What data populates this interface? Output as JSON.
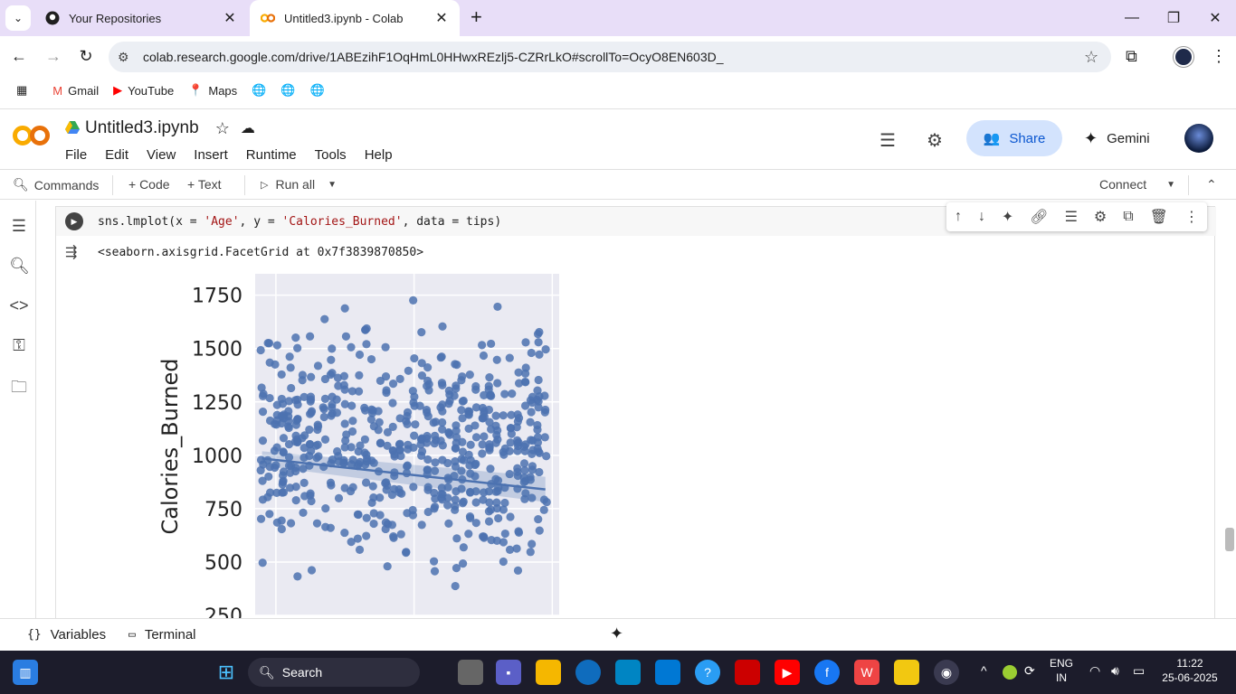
{
  "browser": {
    "tabs": [
      {
        "title": "Your Repositories",
        "icon": "github-icon"
      },
      {
        "title": "Untitled3.ipynb - Colab",
        "icon": "colab-icon"
      }
    ],
    "url": "colab.research.google.com/drive/1ABEzihF1OqHmL0HHwxREzlj5-CZRrLkO#scrollTo=OcyO8EN603D_",
    "bookmarks": [
      {
        "label": "Gmail",
        "icon": "gmail-icon"
      },
      {
        "label": "YouTube",
        "icon": "youtube-icon"
      },
      {
        "label": "Maps",
        "icon": "maps-icon"
      }
    ]
  },
  "colab": {
    "notebook_name": "Untitled3.ipynb",
    "menu": [
      "File",
      "Edit",
      "View",
      "Insert",
      "Runtime",
      "Tools",
      "Help"
    ],
    "share_label": "Share",
    "gemini_label": "Gemini",
    "toolbar": {
      "commands": "Commands",
      "code": "+ Code",
      "text": "+ Text",
      "run_all": "Run all",
      "connect": "Connect"
    },
    "cell": {
      "code_prefix": "sns.lmplot(x = ",
      "x_str": "'Age'",
      "mid": ", y = ",
      "y_str": "'Calories_Burned'",
      "suffix": ", data = tips)",
      "output": "<seaborn.axisgrid.FacetGrid at 0x7f3839870850>"
    },
    "bottom": {
      "variables": "Variables",
      "terminal": "Terminal"
    }
  },
  "chart_data": {
    "type": "scatter",
    "title": "",
    "xlabel": "",
    "ylabel": "Calories_Burned",
    "y_ticks": [
      "1750",
      "1500",
      "1250",
      "1000",
      "750",
      "500",
      "250"
    ],
    "ylim": [
      250,
      1850
    ],
    "xlim": [
      17,
      61
    ],
    "regression": {
      "x": [
        18,
        59
      ],
      "y": [
        985,
        840
      ]
    },
    "point_color": "#4c72b0",
    "background": "#eaeaf2",
    "points_note_count": 600
  },
  "taskbar": {
    "search_label": "Search",
    "lang": "ENG",
    "region": "IN",
    "time": "11:22",
    "date": "25-06-2025"
  }
}
